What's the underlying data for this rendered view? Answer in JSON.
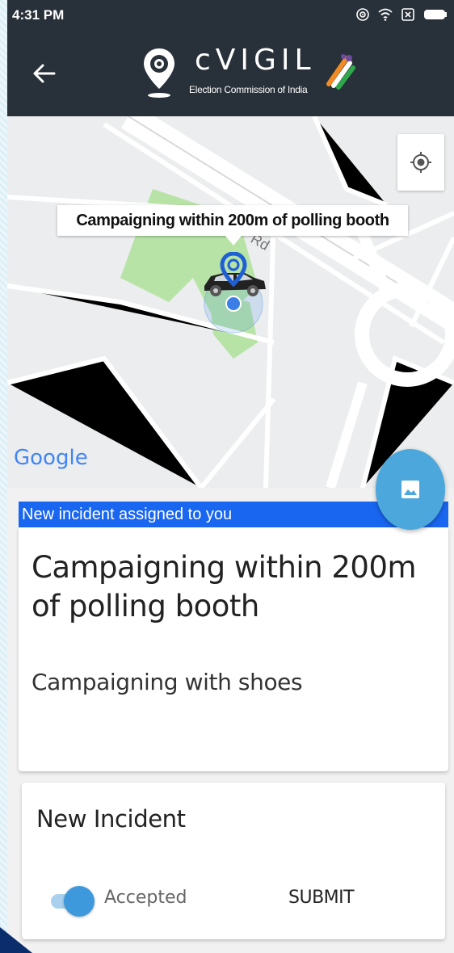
{
  "status_bar": {
    "time": "4:31 PM"
  },
  "app_bar": {
    "title": "cVIGIL",
    "subtitle": "Election Commission of India"
  },
  "map": {
    "marker_label": "Campaigning within 200m of polling booth",
    "google_logo": "Google",
    "road_fragment": "Rd"
  },
  "incident": {
    "banner": "New incident assigned to you",
    "title": "Campaigning within 200m of polling booth",
    "description": "Campaigning with shoes"
  },
  "action_card": {
    "heading": "New Incident",
    "toggle_label": "Accepted",
    "toggle_on": true,
    "submit_label": "SUBMIT"
  },
  "colors": {
    "app_bar": "#283039",
    "banner": "#1966f0",
    "fab": "#4ca8dc",
    "toggle": "#3d99dc"
  }
}
